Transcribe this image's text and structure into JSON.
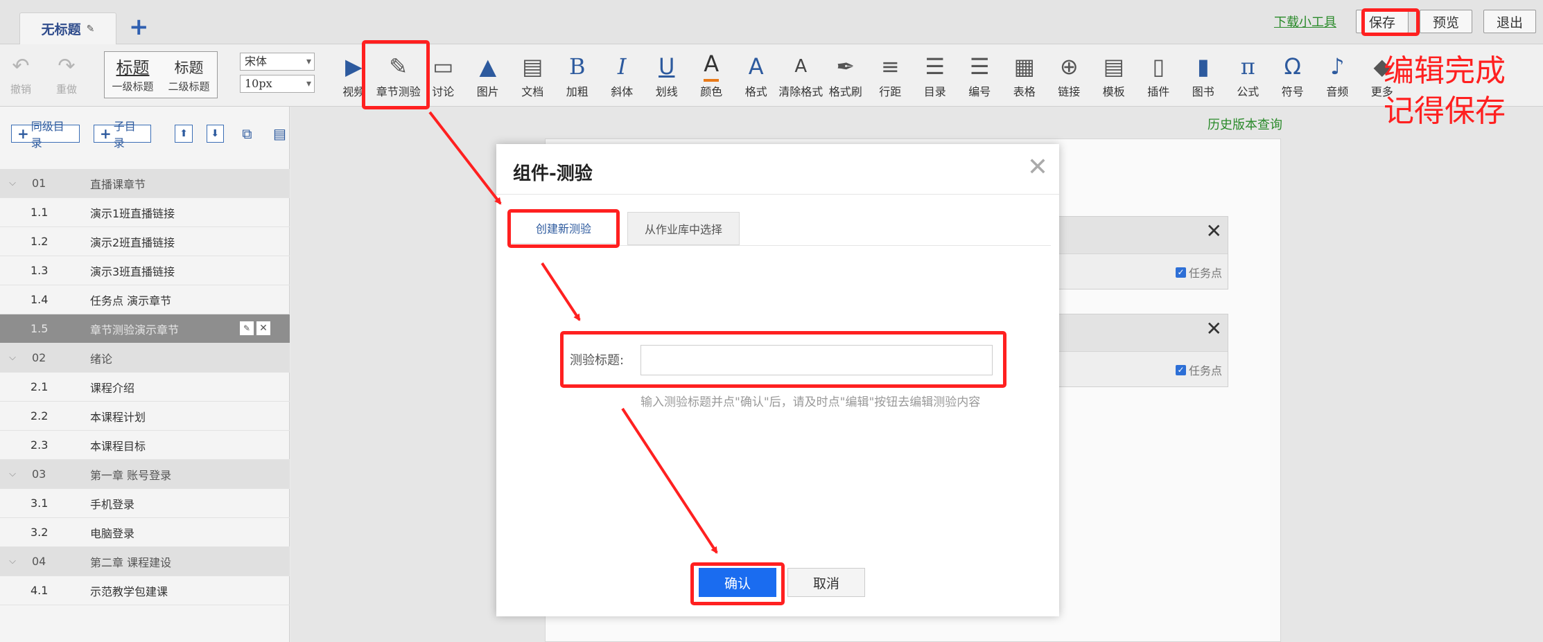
{
  "topbar": {
    "doc_tab": "无标题",
    "add_tab": "+",
    "download_link": "下载小工具",
    "save": "保存",
    "preview": "预览",
    "exit": "退出"
  },
  "toolbar": {
    "undo": "撤销",
    "redo": "重做",
    "heading1_big": "标题",
    "heading1_label": "一级标题",
    "heading2_big": "标题",
    "heading2_label": "二级标题",
    "font_family": "宋体",
    "font_size": "10px",
    "tools": [
      {
        "label": "视频",
        "icon": "▶",
        "name": "video"
      },
      {
        "label": "章节测验",
        "icon": "✎",
        "name": "chapter-quiz"
      },
      {
        "label": "讨论",
        "icon": "▭",
        "name": "discussion"
      },
      {
        "label": "图片",
        "icon": "▲",
        "name": "image"
      },
      {
        "label": "文档",
        "icon": "▤",
        "name": "document"
      },
      {
        "label": "加粗",
        "icon": "B",
        "name": "bold"
      },
      {
        "label": "斜体",
        "icon": "I",
        "name": "italic"
      },
      {
        "label": "划线",
        "icon": "U",
        "name": "underline"
      },
      {
        "label": "颜色",
        "icon": "A",
        "name": "color"
      },
      {
        "label": "格式",
        "icon": "A",
        "name": "format"
      },
      {
        "label": "清除格式",
        "icon": "A",
        "name": "clear-format"
      },
      {
        "label": "格式刷",
        "icon": "✒",
        "name": "format-painter"
      },
      {
        "label": "行距",
        "icon": "≡",
        "name": "line-spacing"
      },
      {
        "label": "目录",
        "icon": "☰",
        "name": "toc"
      },
      {
        "label": "编号",
        "icon": "☰",
        "name": "numbering"
      },
      {
        "label": "表格",
        "icon": "▦",
        "name": "table"
      },
      {
        "label": "链接",
        "icon": "⊕",
        "name": "link"
      },
      {
        "label": "模板",
        "icon": "▤",
        "name": "template"
      },
      {
        "label": "插件",
        "icon": "▯",
        "name": "plugin"
      },
      {
        "label": "图书",
        "icon": "▮",
        "name": "book"
      },
      {
        "label": "公式",
        "icon": "π",
        "name": "formula"
      },
      {
        "label": "符号",
        "icon": "Ω",
        "name": "symbol"
      },
      {
        "label": "音频",
        "icon": "♪",
        "name": "audio"
      },
      {
        "label": "更多",
        "icon": "◆",
        "name": "more"
      }
    ]
  },
  "left_panel": {
    "add_sibling": "同级目录",
    "add_child": "子目录",
    "chapters": [
      {
        "num": "01",
        "title": "直播课章节",
        "kind": "ch"
      },
      {
        "num": "1.1",
        "title": "演示1班直播链接",
        "kind": "sub"
      },
      {
        "num": "1.2",
        "title": "演示2班直播链接",
        "kind": "sub"
      },
      {
        "num": "1.3",
        "title": "演示3班直播链接",
        "kind": "sub"
      },
      {
        "num": "1.4",
        "title": "任务点 演示章节",
        "kind": "sub"
      },
      {
        "num": "1.5",
        "title": "章节测验演示章节",
        "kind": "active"
      },
      {
        "num": "02",
        "title": "绪论",
        "kind": "ch"
      },
      {
        "num": "2.1",
        "title": "课程介绍",
        "kind": "sub"
      },
      {
        "num": "2.2",
        "title": "本课程计划",
        "kind": "sub"
      },
      {
        "num": "2.3",
        "title": "本课程目标",
        "kind": "sub"
      },
      {
        "num": "03",
        "title": "第一章 账号登录",
        "kind": "ch"
      },
      {
        "num": "3.1",
        "title": "手机登录",
        "kind": "sub"
      },
      {
        "num": "3.2",
        "title": "电脑登录",
        "kind": "sub"
      },
      {
        "num": "04",
        "title": "第二章 课程建设",
        "kind": "ch"
      },
      {
        "num": "4.1",
        "title": "示范教学包建课",
        "kind": "sub"
      }
    ]
  },
  "editor": {
    "history": "历史版本查询",
    "task_point": "任务点"
  },
  "modal": {
    "title": "组件-测验",
    "tab_create": "创建新测验",
    "tab_library": "从作业库中选择",
    "field_label": "测验标题:",
    "field_value": "",
    "hint": "输入测验标题并点\"确认\"后，请及时点\"编辑\"按钮去编辑测验内容",
    "confirm": "确认",
    "cancel": "取消"
  },
  "annotation": {
    "line1": "编辑完成",
    "line2": "记得保存",
    "color": "#ff2020"
  }
}
